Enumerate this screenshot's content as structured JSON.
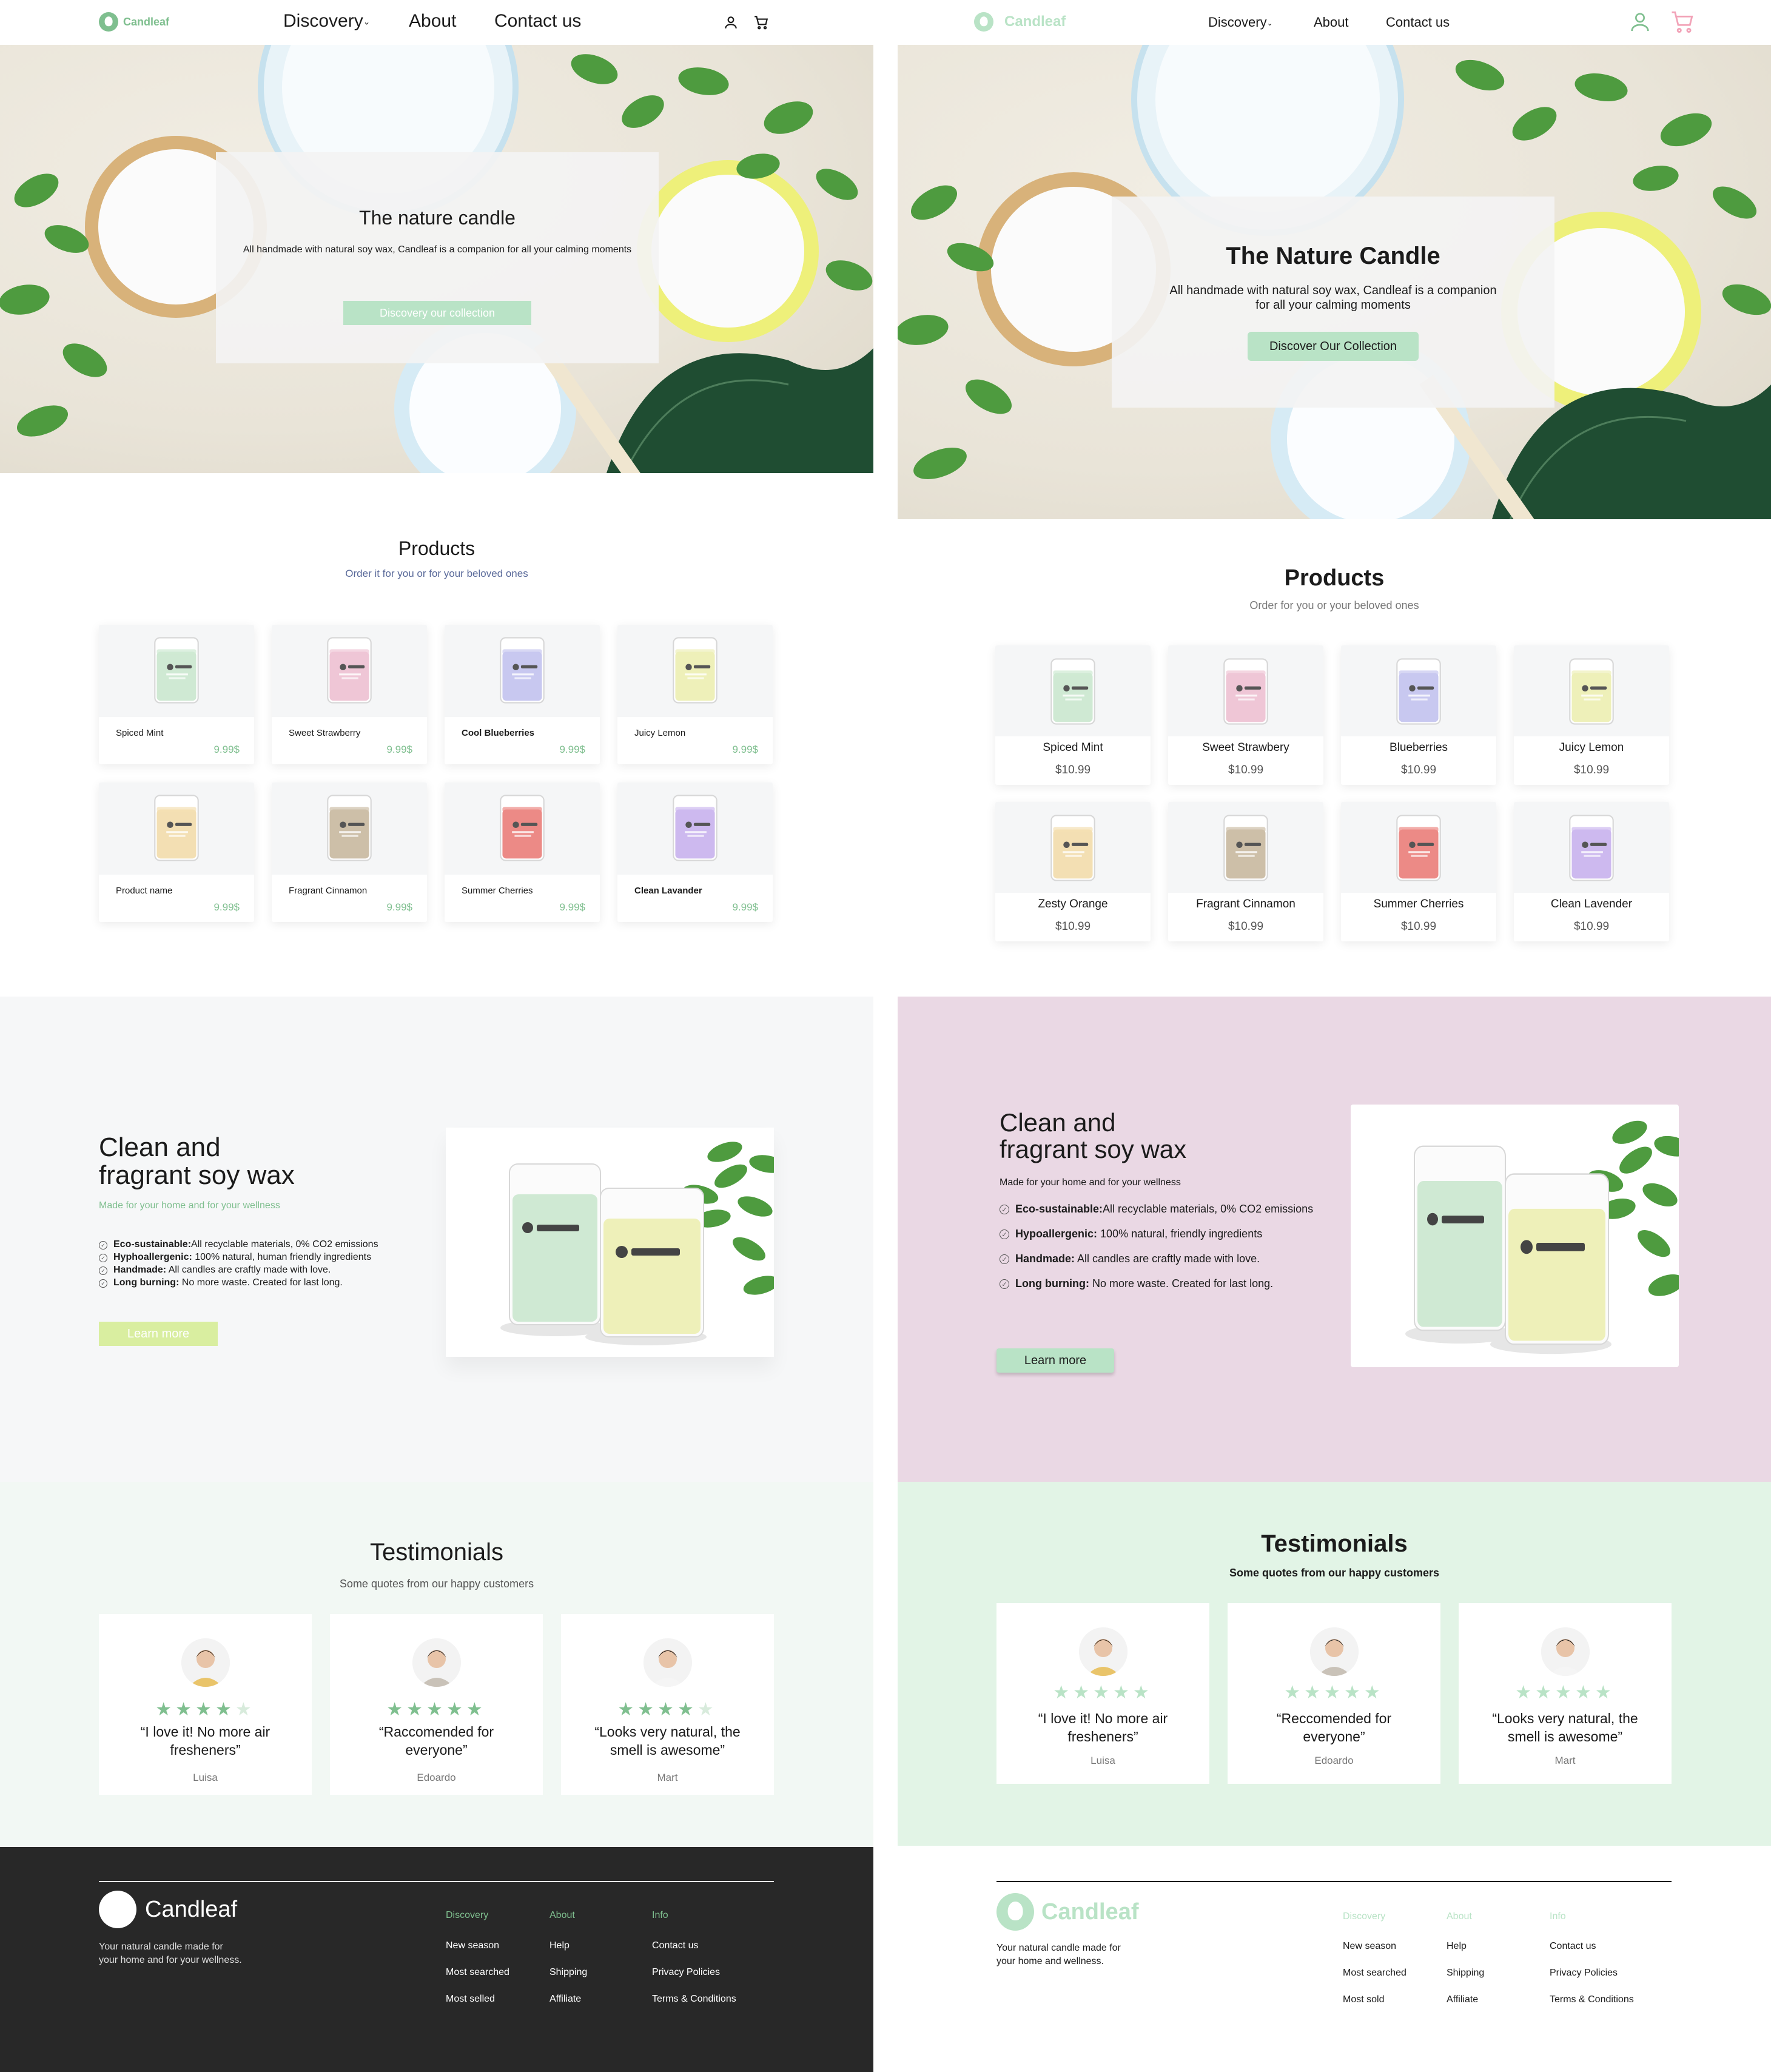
{
  "colors": {
    "green": "#7fbf8f",
    "lightGreen": "#b9e3c6",
    "lime": "#d9eea0",
    "pink": "#ead8e4",
    "mint": "#e2f4e6",
    "dark": "#282828",
    "pinkIcon": "#f2a3b8"
  },
  "v1": {
    "nav": {
      "logo": "Candleaf",
      "links": [
        "Discovery",
        "About",
        "Contact us"
      ]
    },
    "hero": {
      "title": "The nature candle",
      "text": "All handmade with natural soy wax, Candleaf is a companion for all your calming moments",
      "button": "Discovery our collection"
    },
    "products": {
      "title": "Products",
      "subtitle": "Order it for you or for your beloved ones",
      "items": [
        {
          "name": "Spiced Mint",
          "price": "9.99$",
          "color": "#cfe9d3"
        },
        {
          "name": "Sweet Strawberry",
          "price": "9.99$",
          "color": "#efc6d6"
        },
        {
          "name": "Cool Blueberries",
          "price": "9.99$",
          "color": "#c8c8f0"
        },
        {
          "name": "Juicy Lemon",
          "price": "9.99$",
          "color": "#eef0b9"
        },
        {
          "name": "Product name",
          "price": "9.99$",
          "color": "#f3dfb3"
        },
        {
          "name": "Fragrant Cinnamon",
          "price": "9.99$",
          "color": "#cdbfa8"
        },
        {
          "name": "Summer Cherries",
          "price": "9.99$",
          "color": "#ec8a86"
        },
        {
          "name": "Clean Lavander",
          "price": "9.99$",
          "color": "#cdb9ef"
        }
      ]
    },
    "feature": {
      "title1": "Clean and",
      "title2": "fragrant soy wax",
      "subtitle": "Made for your home and for your wellness",
      "items": [
        {
          "label": "Eco-sustainable:",
          "text": "All recyclable materials, 0% CO2 emissions"
        },
        {
          "label": "Hyphoallergenic:",
          "text": " 100% natural, human friendly ingredients"
        },
        {
          "label": "Handmade:",
          "text": " All candles are craftly made with love."
        },
        {
          "label": "Long burning:",
          "text": " No more waste. Created for last long."
        }
      ],
      "button": "Learn more"
    },
    "testimonials": {
      "title": "Testimonials",
      "subtitle": "Some quotes from our happy customers",
      "items": [
        {
          "quote": "“I love it! No more air fresheners”",
          "name": "Luisa",
          "rating": 4
        },
        {
          "quote": "“Raccomended for everyone”",
          "name": "Edoardo",
          "rating": 5
        },
        {
          "quote": "“Looks very natural, the smell is awesome”",
          "name": "Mart",
          "rating": 4
        }
      ]
    },
    "footer": {
      "logo": "Candleaf",
      "tagline1": "Your natural candle made for",
      "tagline2": "your home and for your wellness.",
      "columns": [
        {
          "title": "Discovery",
          "links": [
            "New season",
            "Most searched",
            "Most selled"
          ]
        },
        {
          "title": "About",
          "links": [
            "Help",
            "Shipping",
            "Affiliate"
          ]
        },
        {
          "title": "Info",
          "links": [
            "Contact us",
            "Privacy Policies",
            "Terms & Conditions"
          ]
        }
      ]
    }
  },
  "v2": {
    "nav": {
      "logo": "Candleaf",
      "links": [
        "Discovery",
        "About",
        "Contact us"
      ]
    },
    "hero": {
      "title": "The Nature Candle",
      "text": "All handmade with natural soy wax, Candleaf is a companion for all your calming moments",
      "button": "Discover Our Collection"
    },
    "products": {
      "title": "Products",
      "subtitle": "Order for you or your beloved ones",
      "items": [
        {
          "name": "Spiced Mint",
          "price": "$10.99",
          "color": "#cfe9d3"
        },
        {
          "name": "Sweet Strawbery",
          "price": "$10.99",
          "color": "#efc6d6"
        },
        {
          "name": "Blueberries",
          "price": "$10.99",
          "color": "#c8c8f0"
        },
        {
          "name": "Juicy Lemon",
          "price": "$10.99",
          "color": "#eef0b9"
        },
        {
          "name": "Zesty Orange",
          "price": "$10.99",
          "color": "#f3dfb3"
        },
        {
          "name": "Fragrant Cinnamon",
          "price": "$10.99",
          "color": "#cdbfa8"
        },
        {
          "name": "Summer Cherries",
          "price": "$10.99",
          "color": "#ec8a86"
        },
        {
          "name": "Clean Lavender",
          "price": "$10.99",
          "color": "#cdb9ef"
        }
      ]
    },
    "feature": {
      "title1": "Clean and",
      "title2": "fragrant soy wax",
      "subtitle": "Made for your home and for your wellness",
      "items": [
        {
          "label": "Eco-sustainable:",
          "text": "All recyclable materials, 0% CO2 emissions"
        },
        {
          "label": "Hypoallergenic:",
          "text": " 100% natural, friendly ingredients"
        },
        {
          "label": "Handmade:",
          "text": " All candles are craftly made with love."
        },
        {
          "label": "Long burning:",
          "text": " No more waste. Created for last long."
        }
      ],
      "button": "Learn more"
    },
    "testimonials": {
      "title": "Testimonials",
      "subtitle": "Some quotes from our happy customers",
      "items": [
        {
          "quote": "“I love it! No more air fresheners”",
          "name": "Luisa",
          "rating": 5
        },
        {
          "quote": "“Reccomended for everyone”",
          "name": "Edoardo",
          "rating": 5
        },
        {
          "quote": "“Looks very natural, the smell is awesome”",
          "name": "Mart",
          "rating": 5
        }
      ]
    },
    "footer": {
      "logo": "Candleaf",
      "tagline1": "Your natural candle made for",
      "tagline2": "your home and wellness.",
      "columns": [
        {
          "title": "Discovery",
          "links": [
            "New season",
            "Most searched",
            "Most sold"
          ]
        },
        {
          "title": "About",
          "links": [
            "Help",
            "Shipping",
            "Affiliate"
          ]
        },
        {
          "title": "Info",
          "links": [
            "Contact us",
            "Privacy Policies",
            "Terms & Conditions"
          ]
        }
      ]
    }
  },
  "jarLabel": "Candleaf",
  "jarTexts": {
    "mint": [
      "SPICED MINT",
      "100% Natural"
    ],
    "lemon": [
      "JUICY LEMON",
      "100% Natural"
    ]
  }
}
